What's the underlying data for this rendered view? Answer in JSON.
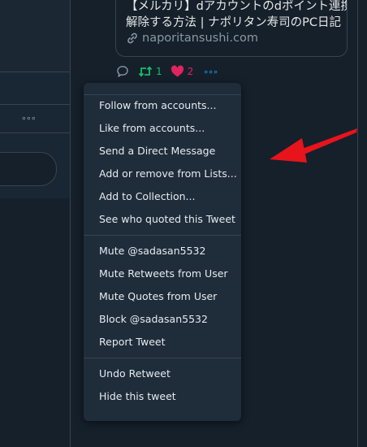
{
  "card": {
    "title_line1": "【メルカリ】dアカウントのdポイント連携を",
    "title_line2": "解除する方法 | ナポリタン寿司のPC日記",
    "url": "naporitansushi.com"
  },
  "actions": {
    "retweet_count": "1",
    "like_count": "2",
    "more_glyph": "∘∘∘"
  },
  "left": {
    "more_glyph": "∘∘∘"
  },
  "menu": {
    "group1": [
      "Follow from accounts...",
      "Like from accounts...",
      "Send a Direct Message",
      "Add or remove from Lists...",
      "Add to Collection...",
      "See who quoted this Tweet"
    ],
    "group2": [
      "Mute @sadasan5532",
      "Mute Retweets from User",
      "Mute Quotes from User",
      "Block @sadasan5532",
      "Report Tweet"
    ],
    "group3": [
      "Undo Retweet",
      "Hide this tweet"
    ]
  },
  "colors": {
    "background": "#15202b",
    "menu": "#1f2c3a",
    "retweet": "#17bf63",
    "like": "#e0245e",
    "accent": "#1da1f2",
    "annotation_arrow": "#e8141b"
  }
}
